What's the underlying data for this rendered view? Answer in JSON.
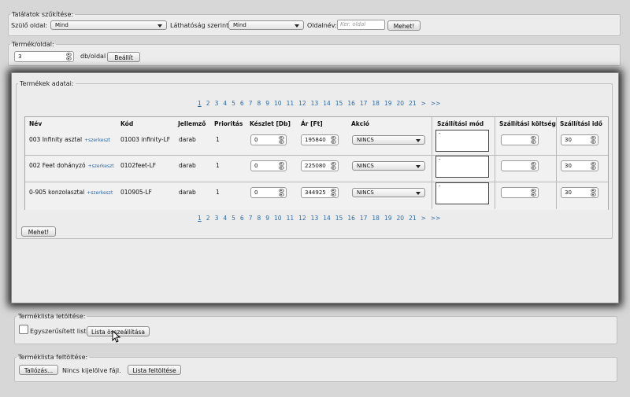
{
  "filter": {
    "legend": "Találatok szűkítése:",
    "parent_label": "Szülő oldal:",
    "parent_value": "Mind",
    "visibility_label": "Láthatóság szerint:",
    "visibility_value": "Mind",
    "pagename_label": "Oldalnév:",
    "pagename_placeholder": "Ker. oldal",
    "go_label": "Mehet!"
  },
  "perpage": {
    "legend": "Termék/oldal:",
    "value": "3",
    "unit": "db/oldal",
    "set_label": "Beállít"
  },
  "products": {
    "legend": "Termékek adatai:",
    "pages": [
      "1",
      "2",
      "3",
      "4",
      "5",
      "6",
      "7",
      "8",
      "9",
      "10",
      "11",
      "12",
      "13",
      "14",
      "15",
      "16",
      "17",
      "18",
      "19",
      "20",
      "21",
      ">",
      ">>"
    ],
    "current_page": "1",
    "headers": {
      "name": "Név",
      "code": "Kód",
      "unit": "Jellemző",
      "priority": "Prioritás",
      "stock": "Készlet [Db]",
      "price": "Ár [Ft]",
      "action": "Akció",
      "shipping_mode": "Szállítási mód",
      "shipping_cost": "Szállítási költség",
      "shipping_time": "Szállítási idő"
    },
    "edit_link": "+szerkeszt",
    "rows": [
      {
        "name": "003 Infinity asztal",
        "code": "01003 infinity-LF",
        "unit": "darab",
        "priority": "1",
        "stock": "0",
        "price": "195840",
        "action": "NINCS",
        "shipping_mode": "-",
        "shipping_cost": "",
        "shipping_time": "30"
      },
      {
        "name": "002 Feet dohányzó",
        "code": "0102feet-LF",
        "unit": "darab",
        "priority": "1",
        "stock": "0",
        "price": "225080",
        "action": "NINCS",
        "shipping_mode": "-",
        "shipping_cost": "",
        "shipping_time": "30"
      },
      {
        "name": "0-905 konzolasztal",
        "code": "010905-LF",
        "unit": "darab",
        "priority": "1",
        "stock": "0",
        "price": "344925",
        "action": "NINCS",
        "shipping_mode": "-",
        "shipping_cost": "",
        "shipping_time": "30"
      }
    ],
    "go_label": "Mehet!"
  },
  "download": {
    "legend": "Terméklista letöltése:",
    "simplified_label": "Egyszerűsített lista",
    "compile_label": "Lista összeállítása"
  },
  "upload": {
    "legend": "Terméklista feltöltése:",
    "browse_label": "Tallózás...",
    "no_file": "Nincs kijelölve fájl.",
    "upload_label": "Lista feltöltése"
  },
  "colors": {
    "link": "#2a6aa8",
    "backdrop": "#111111",
    "panel": "#ececec"
  }
}
